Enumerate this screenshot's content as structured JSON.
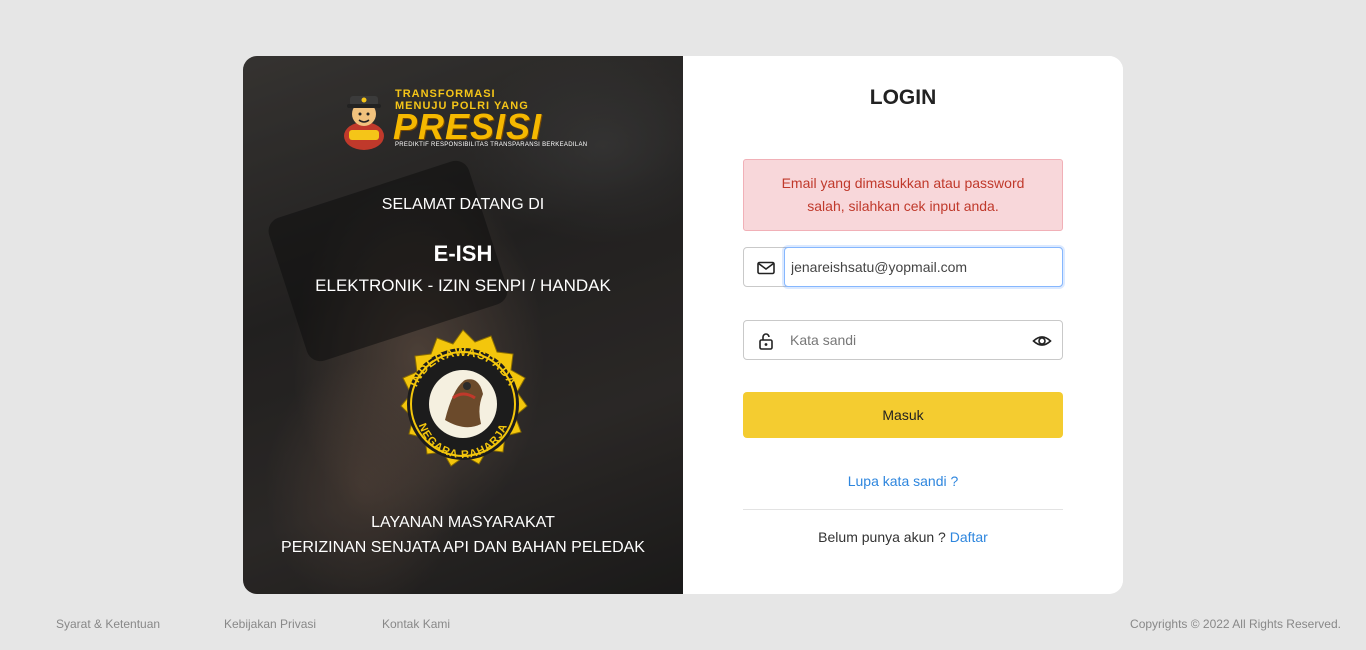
{
  "hero": {
    "logo_line1": "TRANSFORMASI",
    "logo_line2": "MENUJU POLRI YANG",
    "logo_word": "PRESISI",
    "logo_sub": "PREDIKTIF  RESPONSIBILITAS  TRANSPARANSI BERKEADILAN",
    "welcome": "SELAMAT DATANG DI",
    "app_name": "E-ISH",
    "app_full": "ELEKTRONIK - IZIN SENPI / HANDAK",
    "emblem_top_text": "INDERAWASPADA",
    "emblem_bottom_text": "NEGARA RAHARJA",
    "footer_line1": "LAYANAN MASYARAKAT",
    "footer_line2": "PERIZINAN SENJATA API DAN BAHAN PELEDAK"
  },
  "login": {
    "title": "LOGIN",
    "error": "Email yang dimasukkan atau password salah, silahkan cek input anda.",
    "email_value": "jenareishsatu@yopmail.com",
    "password_placeholder": "Kata sandi",
    "submit_label": "Masuk",
    "forgot_label": "Lupa kata sandi ?",
    "no_account_text": "Belum punya akun ?",
    "register_label": "Daftar"
  },
  "footer": {
    "terms": "Syarat & Ketentuan",
    "privacy": "Kebijakan Privasi",
    "contact": "Kontak Kami",
    "copyright": "Copyrights © 2022 All Rights Reserved."
  },
  "colors": {
    "accent_yellow": "#f4cc30",
    "link_blue": "#2e86de",
    "error_bg": "#f8d7da",
    "error_text": "#c0392b",
    "page_bg": "#e6e6e6"
  },
  "icons": {
    "email": "mail-icon",
    "password": "lock-icon",
    "toggle": "eye-icon",
    "mascot": "police-mascot-icon",
    "emblem": "emblem-seal-icon"
  }
}
